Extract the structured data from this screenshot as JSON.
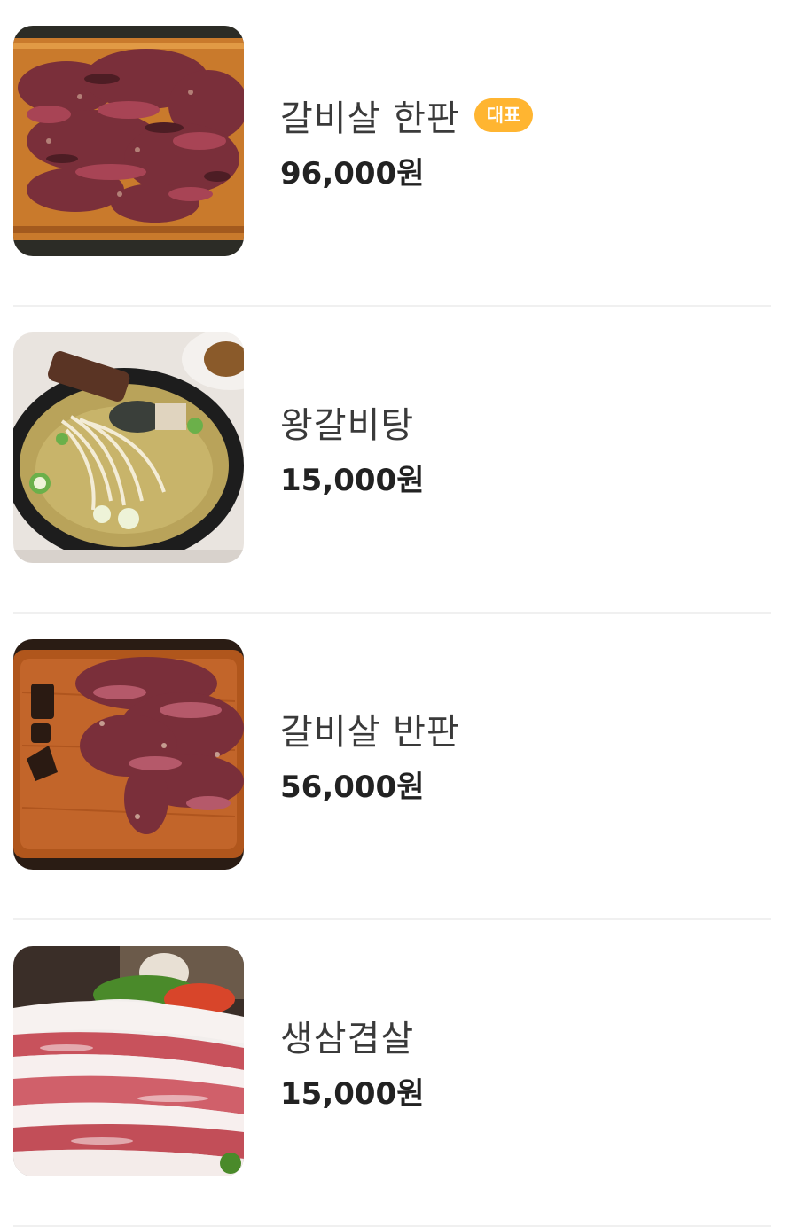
{
  "menu": {
    "items": [
      {
        "name": "갈비살 한판",
        "badge": "대표",
        "price": "96,000원",
        "image_icon": "grilled-rib-meat-platter"
      },
      {
        "name": "왕갈비탕",
        "price": "15,000원",
        "image_icon": "galbitang-soup-bowl"
      },
      {
        "name": "갈비살 반판",
        "price": "56,000원",
        "image_icon": "rib-meat-wooden-board"
      },
      {
        "name": "생삼겹살",
        "price": "15,000원",
        "image_icon": "raw-pork-belly-plate"
      }
    ]
  },
  "colors": {
    "badge": "#ffb531",
    "name_text": "#3a3a3a",
    "price_text": "#222222",
    "divider": "#f0f0f0"
  }
}
